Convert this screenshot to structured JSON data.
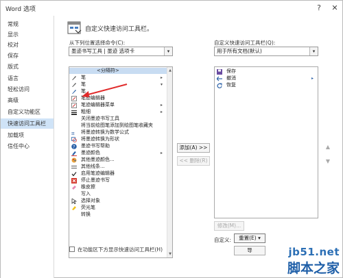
{
  "window": {
    "title": "Word 选项"
  },
  "titlebar": {
    "help_glyph": "?",
    "close_glyph": "✕"
  },
  "sidebar": {
    "items": [
      {
        "label": "常规"
      },
      {
        "label": "显示"
      },
      {
        "label": "校对"
      },
      {
        "label": "保存"
      },
      {
        "label": "版式"
      },
      {
        "label": "语言"
      },
      {
        "label": "轻松访问"
      },
      {
        "label": "高级"
      },
      {
        "label": "自定义功能区"
      },
      {
        "label": "快速访问工具栏",
        "active": true
      },
      {
        "label": "加载项"
      },
      {
        "label": "信任中心"
      }
    ]
  },
  "main": {
    "header": "自定义快速访问工具栏。",
    "from_label": "从下列位置选择命令(C):",
    "from_value": "墨迹书写工具 | 墨迹 选项卡",
    "customize_label": "自定义快速访问工具栏(Q):",
    "customize_value": "用于所有文档(默认)",
    "commands": [
      {
        "label": "<分隔符>",
        "icon": "separator-icon"
      },
      {
        "label": "笔",
        "icon": "pen-icon",
        "sub": "▸"
      },
      {
        "label": "笔",
        "icon": "pen-icon",
        "sub": "▾"
      },
      {
        "label": "笔",
        "icon": "pen-icon"
      },
      {
        "label": "笔迹编辑器",
        "icon": "ink-editor-icon"
      },
      {
        "label": "笔迹编辑器菜单",
        "icon": "ink-editor-menu-icon",
        "sub": "▸"
      },
      {
        "label": "粗细",
        "icon": "thickness-icon",
        "sub": "▸"
      },
      {
        "label": "关闭墨迹书写工具",
        "icon": "close-ink-tools-icon"
      },
      {
        "label": "将当前绘图笔添加到绘图笔收藏夹",
        "icon": "add-pen-favorite-icon"
      },
      {
        "label": "将墨迹转换为数学公式",
        "icon": "ink-to-math-icon"
      },
      {
        "label": "将墨迹转换为形状",
        "icon": "ink-to-shape-icon"
      },
      {
        "label": "墨迹书写帮助",
        "icon": "ink-help-icon"
      },
      {
        "label": "墨迹颜色",
        "icon": "ink-color-icon",
        "sub": "▸"
      },
      {
        "label": "其他墨迹颜色...",
        "icon": "more-ink-colors-icon"
      },
      {
        "label": "其他线条...",
        "icon": "more-lines-icon"
      },
      {
        "label": "启用笔迹编辑器",
        "icon": "check-icon"
      },
      {
        "label": "停止墨迹书写",
        "icon": "stop-ink-icon"
      },
      {
        "label": "橡皮擦",
        "icon": "eraser-icon"
      },
      {
        "label": "写入",
        "icon": "write-icon"
      },
      {
        "label": "选择对象",
        "icon": "select-objects-icon"
      },
      {
        "label": "荧光笔",
        "icon": "highlighter-icon"
      },
      {
        "label": "转换",
        "icon": "convert-icon"
      }
    ],
    "qat_items": [
      {
        "label": "保存",
        "icon": "save-icon"
      },
      {
        "label": "撤消",
        "icon": "undo-icon",
        "sub": "▸"
      },
      {
        "label": "恢复",
        "icon": "redo-icon"
      }
    ],
    "add_button": "添加(A) >>",
    "remove_button": "<< 删除(R)",
    "modify_button": "修改(M)...",
    "customize_text": "自定义:",
    "reset_button": "重置(E) ▾",
    "import_button": "导",
    "show_below_label": "在功能区下方显示快速访问工具栏(H)"
  },
  "watermark": {
    "url": "jb51.net",
    "cn": "脚本之家"
  },
  "colors": {
    "accent": "#cfe3f7",
    "annotation": "#e02a2a",
    "watermark": "#1f5fa8"
  }
}
